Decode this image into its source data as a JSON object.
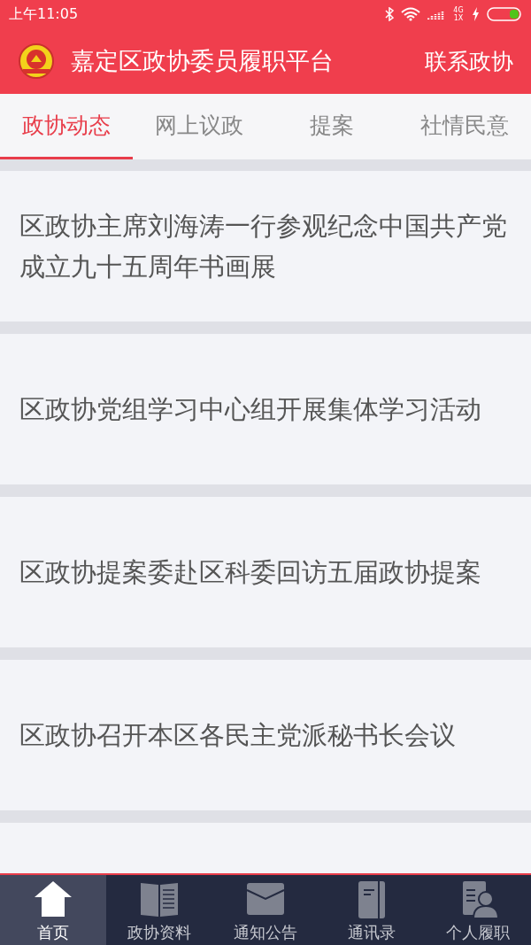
{
  "status_bar": {
    "time": "上午11:05",
    "network": "4G 1X"
  },
  "header": {
    "title": "嘉定区政协委员履职平台",
    "action": "联系政协"
  },
  "tabs": [
    {
      "label": "政协动态",
      "selected": true
    },
    {
      "label": "网上议政",
      "selected": false
    },
    {
      "label": "提案",
      "selected": false
    },
    {
      "label": "社情民意",
      "selected": false
    }
  ],
  "news": [
    {
      "title": "区政协主席刘海涛一行参观纪念中国共产党成立九十五周年书画展"
    },
    {
      "title": "区政协党组学习中心组开展集体学习活动"
    },
    {
      "title": "区政协提案委赴区科委回访五届政协提案"
    },
    {
      "title": "区政协召开本区各民主党派秘书长会议"
    }
  ],
  "bottom_nav": [
    {
      "label": "首页",
      "selected": true
    },
    {
      "label": "政协资料",
      "selected": false
    },
    {
      "label": "通知公告",
      "selected": false
    },
    {
      "label": "通讯录",
      "selected": false
    },
    {
      "label": "个人履职",
      "selected": false
    }
  ]
}
